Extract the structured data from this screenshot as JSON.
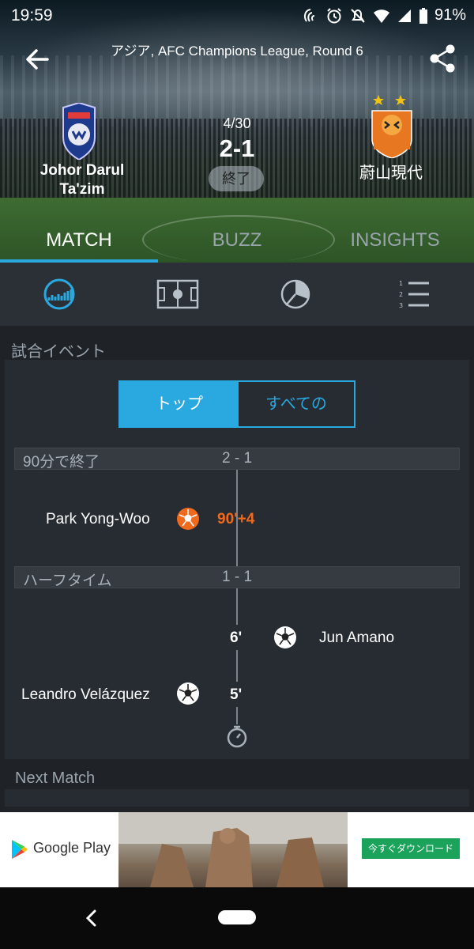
{
  "status_bar": {
    "time": "19:59",
    "battery": "91%"
  },
  "header": {
    "league": "アジア, AFC Champions League, Round 6",
    "home_team_line1": "Johor Darul",
    "home_team_line2": "Ta'zim",
    "away_team": "蔚山現代",
    "date": "4/30",
    "score": "2-1",
    "status": "終了"
  },
  "tabs": [
    {
      "label": "MATCH",
      "active": true
    },
    {
      "label": "BUZZ",
      "active": false
    },
    {
      "label": "INSIGHTS",
      "active": false
    }
  ],
  "icon_bar": [
    {
      "icon": "stats-chart-icon",
      "active": true
    },
    {
      "icon": "pitch-icon",
      "active": false
    },
    {
      "icon": "pie-icon",
      "active": false
    },
    {
      "icon": "ranked-list-icon",
      "active": false
    }
  ],
  "events_section": {
    "title": "試合イベント",
    "filter_top": "トップ",
    "filter_all": "すべての",
    "periods": [
      {
        "label": "90分で終了",
        "score": "2 - 1"
      },
      {
        "label": "ハーフタイム",
        "score": "1 - 1"
      }
    ],
    "events": [
      {
        "player": "Park Yong-Woo",
        "minute": "90'+4",
        "side": "home",
        "type": "own-goal"
      },
      {
        "player": "Jun Amano",
        "minute": "6'",
        "side": "away",
        "type": "goal"
      },
      {
        "player": "Leandro Velázquez",
        "minute": "5'",
        "side": "home",
        "type": "goal"
      }
    ]
  },
  "next_match": {
    "title": "Next Match"
  },
  "ad": {
    "store": "Google Play",
    "cta": "今すぐダウンロード"
  },
  "colors": {
    "accent": "#2aa8e0",
    "own_goal": "#f06a1e",
    "background": "#1f2328",
    "panel": "#262c32"
  }
}
